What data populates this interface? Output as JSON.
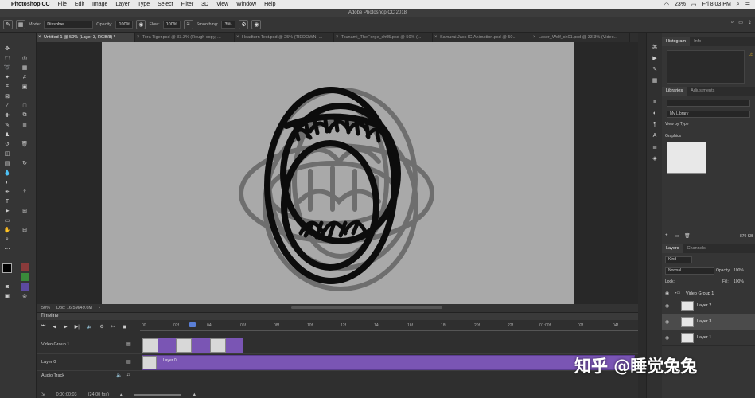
{
  "menubar": {
    "apple": "",
    "app": "Photoshop CC",
    "items": [
      "File",
      "Edit",
      "Image",
      "Layer",
      "Type",
      "Select",
      "Filter",
      "3D",
      "View",
      "Window",
      "Help"
    ],
    "battery": "23%",
    "clock": "Fri 8:03 PM"
  },
  "window": {
    "title": "Adobe Photoshop CC 2018"
  },
  "options": {
    "mode_label": "Mode:",
    "mode_value": "Dissolve",
    "opacity_label": "Opacity:",
    "opacity_value": "100%",
    "flow_label": "Flow:",
    "flow_value": "100%",
    "smoothing_label": "Smoothing:",
    "smoothing_value": "3%"
  },
  "tabs": [
    {
      "label": "Untitled-1 @ 50% (Layer 3, RGB/8) *",
      "active": true
    },
    {
      "label": "Tora Tiger.psd @ 33.3% (Rough copy, ...",
      "active": false
    },
    {
      "label": "Headturn Test.psd @ 25% (TIEDOWN, ...",
      "active": false
    },
    {
      "label": "Tsunami_TheForge_sh05.psd @ 50% (...",
      "active": false
    },
    {
      "label": "Samurai Jack IG Animation.psd @ 50...",
      "active": false
    },
    {
      "label": "Laser_Wolf_sh01.psd @ 33.3% (Video...",
      "active": false
    }
  ],
  "status": {
    "zoom": "50%",
    "doc": "Doc: 16.5M/49.6M"
  },
  "timeline": {
    "title": "Timeline",
    "ruler": [
      "00",
      "02f",
      "04f",
      "06f",
      "08f",
      "10f",
      "12f",
      "14f",
      "16f",
      "18f",
      "20f",
      "22f",
      "01:00f",
      "02f",
      "04f"
    ],
    "tracks": [
      {
        "label": "Video Group 1"
      },
      {
        "label": "Layer 0",
        "clip": "Layer 0"
      },
      {
        "label": "Audio Track"
      }
    ],
    "timecode": "0:00:00:03",
    "fps": "(24.00 fps)"
  },
  "panels": {
    "histogram_tab": "Histogram",
    "info_tab": "Info",
    "libraries_tab": "Libraries",
    "adjustments_tab": "Adjustments",
    "library_name": "My Library",
    "view_by": "View by Type",
    "graphics_header": "Graphics",
    "library_size": "870 KB",
    "layers_tab": "Layers",
    "channels_tab": "Channels",
    "kind": "Kind",
    "blend": "Normal",
    "opacity_label": "Opacity:",
    "opacity": "100%",
    "lock_label": "Lock:",
    "fill_label": "Fill:",
    "fill": "100%",
    "layers": [
      "Video Group 1",
      "Layer 2",
      "Layer 3",
      "Layer 1"
    ]
  },
  "watermark": "知乎 @睡觉兔兔",
  "colors": {
    "accent": "#7a55b4",
    "playhead": "#e04545",
    "canvas": "#a9a9a9"
  }
}
